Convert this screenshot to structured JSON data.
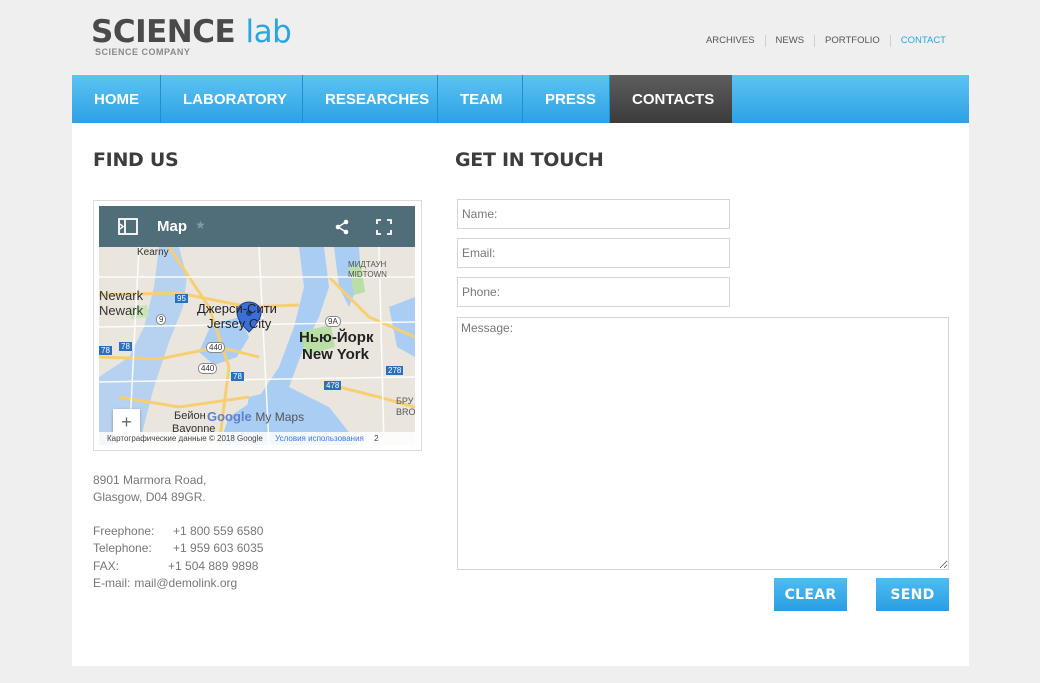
{
  "header": {
    "logo_word1": "SCIENCE",
    "logo_word2": "lab",
    "logo_tagline": "SCIENCE COMPANY"
  },
  "topnav": [
    {
      "label": "ARCHIVES"
    },
    {
      "label": "NEWS"
    },
    {
      "label": "PORTFOLIO"
    },
    {
      "label": "CONTACT",
      "active": true
    }
  ],
  "mainnav": [
    {
      "label": "HOME"
    },
    {
      "label": "LABORATORY"
    },
    {
      "label": "RESEARCHES"
    },
    {
      "label": "TEAM"
    },
    {
      "label": "PRESS"
    },
    {
      "label": "CONTACTS",
      "active": true
    }
  ],
  "find_us": {
    "title": "FIND US",
    "map": {
      "title": "Map",
      "icons": [
        "sidebar-icon",
        "star-icon",
        "share-icon",
        "fullscreen-icon"
      ],
      "labels": {
        "kearny": "Kearny",
        "newark_1": "Newark",
        "newark_2": "Newark",
        "jersey_ru": "Джерси-Сити",
        "jersey_en": "Jersey City",
        "ny_ru": "Нью-Йорк",
        "ny_en": "New York",
        "midtown_1": "МИДТАУН",
        "midtown_2": "MIDTOWN",
        "bayonne_ru": "Бейон",
        "bayonne_en": "Bayonne",
        "bru": "БРУ",
        "bro": "BRO",
        "google": "Google",
        "mymaps": "My Maps"
      },
      "shields": [
        "95",
        "9",
        "78",
        "78",
        "440",
        "440",
        "78",
        "9A",
        "478",
        "278"
      ],
      "zoom_in": "+",
      "zoom_out": "−",
      "footer_data": "Картографические данные © 2018 Google",
      "footer_terms": "Условия использования",
      "footer_num": "2"
    },
    "address_line1": "8901 Marmora Road,",
    "address_line2": "Glasgow, D04 89GR.",
    "freephone_label": "Freephone:",
    "freephone": "+1 800 559 6580",
    "telephone_label": "Telephone:",
    "telephone": "+1 959 603 6035",
    "fax_label": "FAX:",
    "fax": "+1 504 889 9898",
    "email_label": "E-mail:",
    "email": "mail@demolink.org"
  },
  "get_in_touch": {
    "title": "GET IN TOUCH",
    "name_placeholder": "Name:",
    "email_placeholder": "Email:",
    "phone_placeholder": "Phone:",
    "message_placeholder": "Message:",
    "clear_label": "CLEAR",
    "send_label": "SEND"
  },
  "colors": {
    "accent": "#2aa5e2",
    "nav_active": "#474747",
    "map_bar": "#4f6e79"
  }
}
